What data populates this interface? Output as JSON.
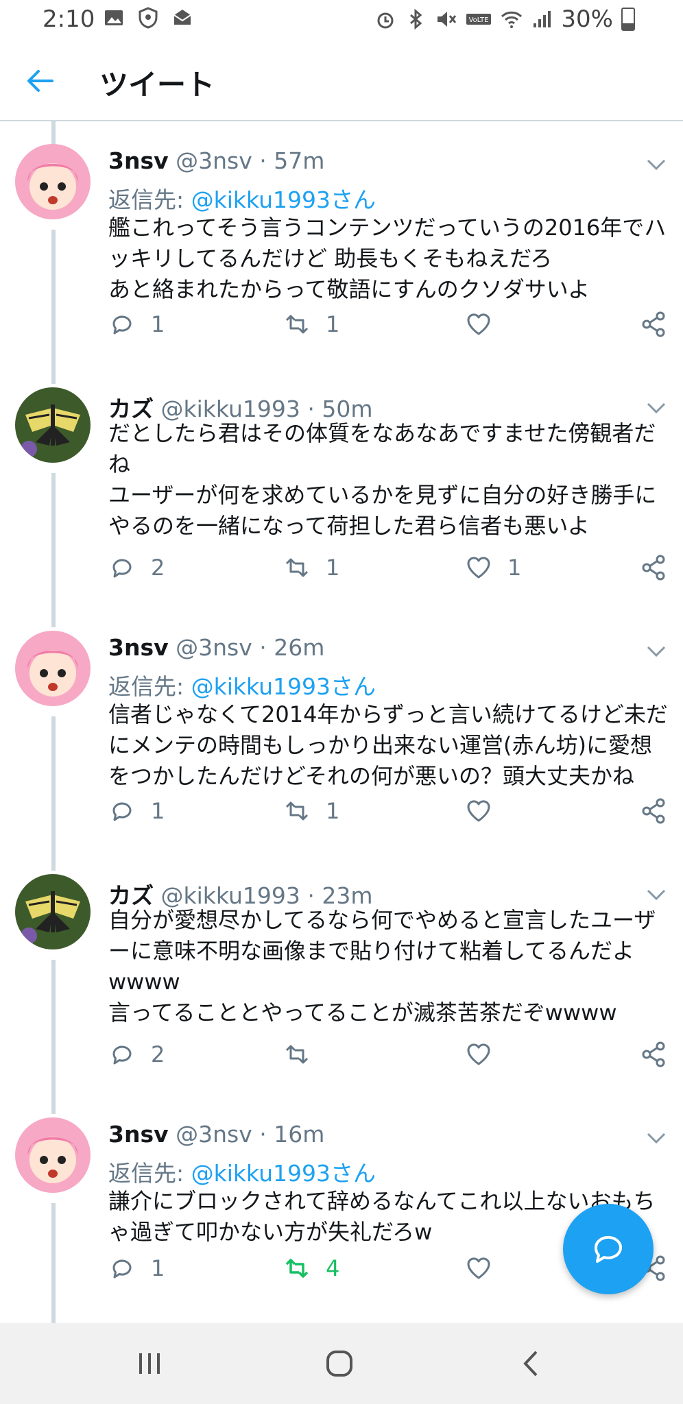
{
  "status_bar": {
    "time": "2:10",
    "battery": "30%"
  },
  "header": {
    "title": "ツイート"
  },
  "tweets": [
    {
      "name": "3nsv",
      "handle": "@3nsv",
      "sep": "·",
      "time": "57m",
      "reply_prefix": "返信先: ",
      "reply_mention": "@kikku1993さん",
      "text": "艦これってそう言うコンテンツだっていうの2016年でハッキリしてるんだけど 助長もくそもねえだろ\nあと絡まれたからって敬語にすんのクソダサいよ",
      "replies": "1",
      "retweets": "1",
      "likes": "",
      "retweeted": false,
      "avatar": "pink-hair-avatar"
    },
    {
      "name": "カズ",
      "handle": "@kikku1993",
      "sep": "·",
      "time": "50m",
      "reply_prefix": "",
      "reply_mention": "",
      "text": "だとしたら君はその体質をなあなあですませた傍観者だね\nユーザーが何を求めているかを見ずに自分の好き勝手にやるのを一緒になって荷担した君ら信者も悪いよ",
      "replies": "2",
      "retweets": "1",
      "likes": "1",
      "retweeted": false,
      "avatar": "butterfly-avatar"
    },
    {
      "name": "3nsv",
      "handle": "@3nsv",
      "sep": "·",
      "time": "26m",
      "reply_prefix": "返信先: ",
      "reply_mention": "@kikku1993さん",
      "text": "信者じゃなくて2014年からずっと言い続けてるけど未だにメンテの時間もしっかり出来ない運営(赤ん坊)に愛想をつかしたんだけどそれの何が悪いの？頭大丈夫かね",
      "replies": "1",
      "retweets": "1",
      "likes": "",
      "retweeted": false,
      "avatar": "pink-hair-avatar"
    },
    {
      "name": "カズ",
      "handle": "@kikku1993",
      "sep": "·",
      "time": "23m",
      "reply_prefix": "",
      "reply_mention": "",
      "text": "自分が愛想尽かしてるなら何でやめると宣言したユーザーに意味不明な画像まで貼り付けて粘着してるんだよwwww\n言ってることとやってることが滅茶苦茶だぞwwww",
      "replies": "2",
      "retweets": "",
      "likes": "",
      "retweeted": false,
      "avatar": "butterfly-avatar"
    },
    {
      "name": "3nsv",
      "handle": "@3nsv",
      "sep": "·",
      "time": "16m",
      "reply_prefix": "返信先: ",
      "reply_mention": "@kikku1993さん",
      "text": "謙介にブロックされて辞めるなんてこれ以上ないおもちゃ過ぎて叩かない方が失礼だろw",
      "replies": "1",
      "retweets": "4",
      "likes": "",
      "retweeted": true,
      "avatar": "pink-hair-avatar"
    }
  ],
  "colors": {
    "accent": "#1da1f2",
    "retweet_active": "#17bf63",
    "muted": "#657786",
    "divider": "#cfd9de"
  }
}
